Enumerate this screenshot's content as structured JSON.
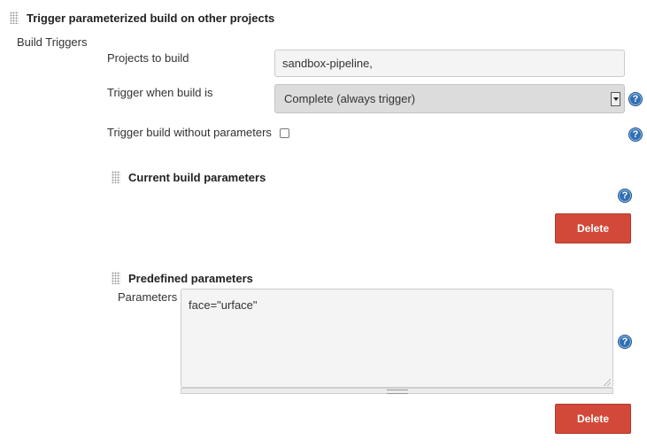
{
  "section": {
    "title": "Trigger parameterized build on other projects",
    "build_triggers_label": "Build Triggers"
  },
  "projects": {
    "label": "Projects to build",
    "value": "sandbox-pipeline,"
  },
  "trigger_when": {
    "label": "Trigger when build is",
    "selected": "Complete (always trigger)"
  },
  "without_params": {
    "label": "Trigger build without parameters",
    "checked": false
  },
  "current_params": {
    "title": "Current build parameters",
    "delete_label": "Delete"
  },
  "predefined_params": {
    "title": "Predefined parameters",
    "field_label": "Parameters",
    "value": "face=\"urface\"",
    "delete_label": "Delete"
  },
  "help_icon_glyph": "?",
  "colors": {
    "delete_button": "#d24939",
    "help_icon": "#2f6fb4"
  }
}
